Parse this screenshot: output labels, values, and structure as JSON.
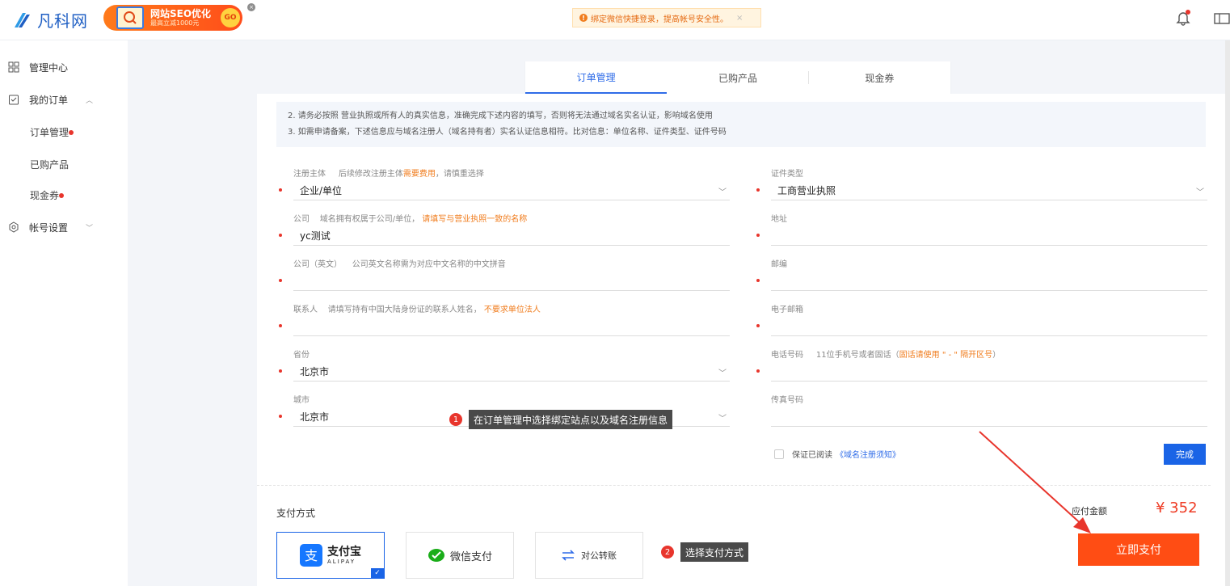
{
  "header": {
    "logo_text": "凡科网",
    "promo": {
      "title": "网站SEO优化",
      "subtitle": "最高立减1000元",
      "go": "GO"
    },
    "notice": "绑定微信快捷登录，提高帐号安全性。",
    "notice_close": "×"
  },
  "sidebar": {
    "items": [
      {
        "label": "管理中心",
        "icon": "grid-icon"
      },
      {
        "label": "我的订单",
        "icon": "order-icon",
        "caret": "^"
      },
      {
        "label": "订单管理",
        "sub": true,
        "dot": true
      },
      {
        "label": "已购产品",
        "sub": true
      },
      {
        "label": "现金券",
        "sub": true,
        "dot": true
      },
      {
        "label": "帐号设置",
        "icon": "settings-icon",
        "caret": "v"
      }
    ]
  },
  "tabs": [
    "订单管理",
    "已购产品",
    "现金券"
  ],
  "info": {
    "line2": "2. 请务必按照 营业执照或所有人的真实信息，准确完成下述内容的填写，否则将无法通过域名实名认证，影响域名使用",
    "line3": "3. 如需申请备案，下述信息应与域名注册人（域名持有者）实名认证信息相符。比对信息：单位名称、证件类型、证件号码"
  },
  "form": {
    "reg_subject": {
      "label": "注册主体",
      "hint": "后续修改注册主体",
      "hint_orange": "需要费用",
      "hint_tail": "，请慎重选择",
      "value": "企业/单位"
    },
    "cert_type": {
      "label": "证件类型",
      "value": "工商营业执照"
    },
    "company": {
      "label": "公司",
      "hint": "域名拥有权属于公司/单位，",
      "hint_orange": "请填写与营业执照一致的名称",
      "value": "yc测试"
    },
    "address": {
      "label": "地址",
      "value": ""
    },
    "company_en": {
      "label": "公司（英文）",
      "hint": "公司英文名称需为对应中文名称的中文拼音",
      "value": ""
    },
    "postcode": {
      "label": "邮编",
      "value": ""
    },
    "contact": {
      "label": "联系人",
      "hint": "请填写持有中国大陆身份证的联系人姓名，",
      "hint_orange": "不要求单位法人",
      "value": ""
    },
    "email": {
      "label": "电子邮箱",
      "value": ""
    },
    "province": {
      "label": "省份",
      "value": "北京市"
    },
    "phone": {
      "label": "电话号码",
      "hint": "11位手机号或者固话（",
      "hint_orange": "固话请使用 \" - \" 隔开区号",
      "hint_tail": "）",
      "value": ""
    },
    "city": {
      "label": "城市",
      "value": "北京市"
    },
    "fax": {
      "label": "传真号码",
      "value": ""
    }
  },
  "tips": [
    {
      "num": "1",
      "text": "在订单管理中选择绑定站点以及域名注册信息"
    },
    {
      "num": "2",
      "text": "选择支付方式"
    }
  ],
  "agree": {
    "text": "保证已阅读",
    "link": "《域名注册须知》"
  },
  "done_label": "完成",
  "payment": {
    "title": "支付方式",
    "options": [
      {
        "label": "支付宝",
        "sub": "ALIPAY",
        "selected": true
      },
      {
        "label": "微信支付"
      },
      {
        "label": "对公转账"
      }
    ],
    "amount_label": "应付金额",
    "amount": "¥ 352",
    "pay_label": "立即支付"
  }
}
